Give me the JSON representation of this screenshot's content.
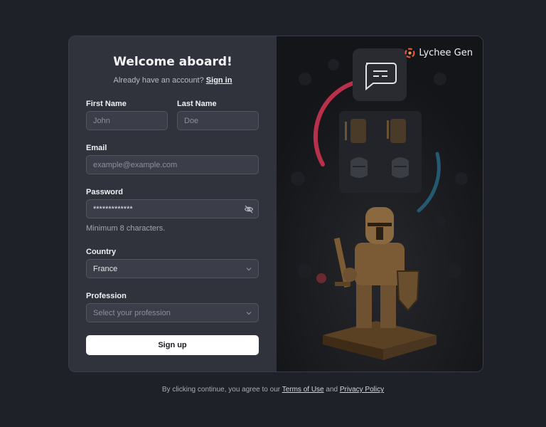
{
  "form": {
    "title": "Welcome aboard!",
    "have_account_text": "Already have an account?",
    "sign_in_link": "Sign in",
    "first_name": {
      "label": "First Name",
      "placeholder": "John"
    },
    "last_name": {
      "label": "Last Name",
      "placeholder": "Doe"
    },
    "email": {
      "label": "Email",
      "placeholder": "example@example.com"
    },
    "password": {
      "label": "Password",
      "value": "*************",
      "hint": "Minimum 8 characters."
    },
    "country": {
      "label": "Country",
      "value": "France"
    },
    "profession": {
      "label": "Profession",
      "placeholder": "Select your profession"
    },
    "submit_label": "Sign up"
  },
  "brand": {
    "name": "Lychee Gen"
  },
  "footer": {
    "prefix": "By clicking continue, you agree to our",
    "terms_link": "Terms of Use",
    "and": "and",
    "privacy_link": "Privacy Policy"
  },
  "icons": {
    "password_toggle": "eye-off-icon",
    "select_chevron": "chevron-down-icon",
    "brand_logo": "lychee-logo-icon",
    "chat": "chat-bubble-icon"
  },
  "colors": {
    "background": "#1f2129",
    "panel": "#30323c",
    "button": "#ffffff",
    "accent_red": "#c23b52",
    "accent_teal": "#2d6f8a"
  }
}
